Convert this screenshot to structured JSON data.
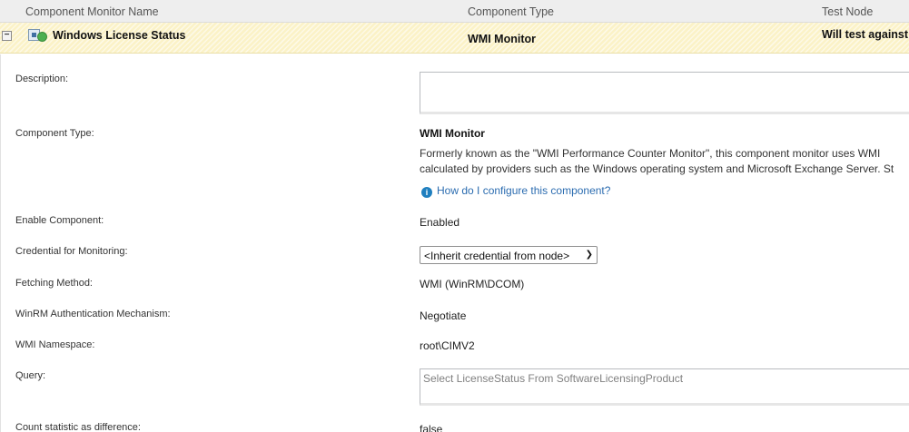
{
  "header": {
    "col_name": "Component Monitor Name",
    "col_type": "Component Type",
    "col_node": "Test Node"
  },
  "component": {
    "collapse_symbol": "−",
    "name": "Windows License Status",
    "type": "WMI Monitor",
    "test_node": "Will test against"
  },
  "details": {
    "description_label": "Description:",
    "description_value": "",
    "component_type_label": "Component Type:",
    "component_type_title": "WMI Monitor",
    "component_type_desc_line1": "Formerly known as the \"WMI Performance Counter Monitor\", this component monitor uses WMI",
    "component_type_desc_line2": "calculated by providers such as the Windows operating system and Microsoft Exchange Server. St",
    "help_icon": "info-icon",
    "help_link": "How do I configure this component?",
    "enable_label": "Enable Component:",
    "enable_value": "Enabled",
    "credential_label": "Credential for Monitoring:",
    "credential_value": "<Inherit credential from node>",
    "fetching_label": "Fetching Method:",
    "fetching_value": "WMI (WinRM\\DCOM)",
    "winrm_label": "WinRM Authentication Mechanism:",
    "winrm_value": "Negotiate",
    "namespace_label": "WMI Namespace:",
    "namespace_value": "root\\CIMV2",
    "query_label": "Query:",
    "query_value": "Select LicenseStatus From SoftwareLicensingProduct",
    "count_label": "Count statistic as difference:",
    "count_value": "false"
  },
  "colors": {
    "header_bg": "#eeeeee",
    "row_highlight": "#fbf2c7",
    "status_up": "#4caf50",
    "link": "#2b6cb0"
  }
}
